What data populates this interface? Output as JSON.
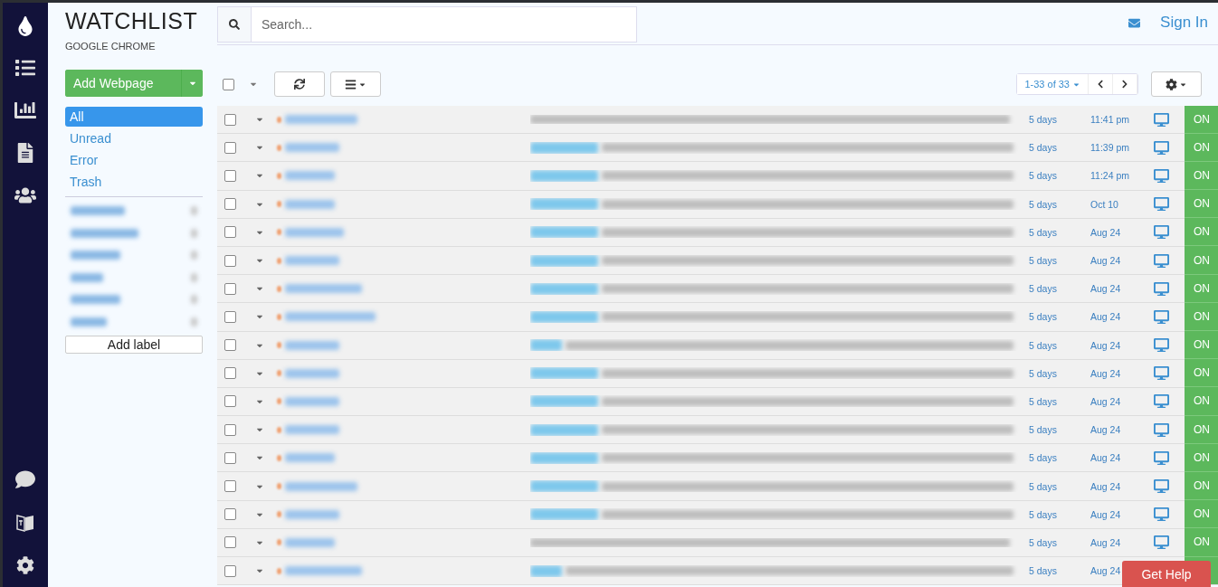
{
  "app": {
    "title": "WATCHLIST",
    "subtitle": "GOOGLE CHROME"
  },
  "search": {
    "placeholder": "Search..."
  },
  "header": {
    "sign_in": "Sign In"
  },
  "sidebar": {
    "add_button": "Add Webpage",
    "filters": [
      {
        "label": "All",
        "selected": true
      },
      {
        "label": "Unread",
        "selected": false
      },
      {
        "label": "Error",
        "selected": false
      },
      {
        "label": "Trash",
        "selected": false
      }
    ],
    "labels": [
      {
        "kind": "redacted"
      },
      {
        "kind": "redacted"
      },
      {
        "kind": "redacted"
      },
      {
        "kind": "redacted"
      },
      {
        "kind": "redacted"
      },
      {
        "kind": "redacted"
      }
    ],
    "add_label": "Add label"
  },
  "toolbar": {
    "select_all_checked": false,
    "pagination": "1-33 of 33"
  },
  "rows": [
    {
      "checked": false,
      "kind": "plain",
      "age": "5 days",
      "time": "11:41 pm",
      "status": "ON"
    },
    {
      "checked": false,
      "kind": "wide",
      "age": "5 days",
      "time": "11:39 pm",
      "status": "ON"
    },
    {
      "checked": false,
      "kind": "wide",
      "age": "5 days",
      "time": "11:24 pm",
      "status": "ON"
    },
    {
      "checked": false,
      "kind": "wide",
      "age": "5 days",
      "time": "Oct 10",
      "status": "ON"
    },
    {
      "checked": false,
      "kind": "wide",
      "age": "5 days",
      "time": "Aug 24",
      "status": "ON"
    },
    {
      "checked": false,
      "kind": "wide",
      "age": "5 days",
      "time": "Aug 24",
      "status": "ON"
    },
    {
      "checked": false,
      "kind": "wide",
      "age": "5 days",
      "time": "Aug 24",
      "status": "ON"
    },
    {
      "checked": false,
      "kind": "wide",
      "age": "5 days",
      "time": "Aug 24",
      "status": "ON"
    },
    {
      "checked": false,
      "kind": "short",
      "age": "5 days",
      "time": "Aug 24",
      "status": "ON"
    },
    {
      "checked": false,
      "kind": "wide",
      "age": "5 days",
      "time": "Aug 24",
      "status": "ON"
    },
    {
      "checked": false,
      "kind": "wide",
      "age": "5 days",
      "time": "Aug 24",
      "status": "ON"
    },
    {
      "checked": false,
      "kind": "wide",
      "age": "5 days",
      "time": "Aug 24",
      "status": "ON"
    },
    {
      "checked": false,
      "kind": "wide",
      "age": "5 days",
      "time": "Aug 24",
      "status": "ON"
    },
    {
      "checked": false,
      "kind": "wide",
      "age": "5 days",
      "time": "Aug 24",
      "status": "ON"
    },
    {
      "checked": false,
      "kind": "wide",
      "age": "5 days",
      "time": "Aug 24",
      "status": "ON"
    },
    {
      "checked": false,
      "kind": "plain",
      "age": "5 days",
      "time": "Aug 24",
      "status": "ON"
    },
    {
      "checked": false,
      "kind": "short",
      "age": "5 days",
      "time": "Aug 24"
    }
  ],
  "help_button": "Get Help"
}
